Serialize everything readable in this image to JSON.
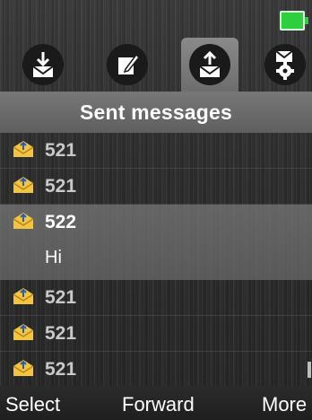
{
  "status_bar": {
    "battery_icon": "battery-full-icon",
    "battery_color": "#2ecf3f"
  },
  "tabs": [
    {
      "icon": "inbox-download-icon",
      "active": false
    },
    {
      "icon": "compose-pencil-icon",
      "active": false
    },
    {
      "icon": "outbox-upload-icon",
      "active": true
    },
    {
      "icon": "message-settings-gear-icon",
      "active": false
    }
  ],
  "header": {
    "title": "Sent messages"
  },
  "messages": [
    {
      "number": "521",
      "preview": "",
      "selected": false,
      "icon": "sent-envelope-icon"
    },
    {
      "number": "521",
      "preview": "",
      "selected": false,
      "icon": "sent-envelope-icon"
    },
    {
      "number": "522",
      "preview": "Hi",
      "selected": true,
      "icon": "sent-envelope-icon"
    },
    {
      "number": "521",
      "preview": "",
      "selected": false,
      "icon": "sent-envelope-icon"
    },
    {
      "number": "521",
      "preview": "",
      "selected": false,
      "icon": "sent-envelope-icon"
    },
    {
      "number": "521",
      "preview": "",
      "selected": false,
      "icon": "sent-envelope-icon"
    }
  ],
  "softkeys": {
    "left": "Select",
    "center": "Forward",
    "right": "More"
  },
  "colors": {
    "accent_tab": "#7a7a7a",
    "header_bg": "#6a6a6a",
    "selected_row": "#6e6e6e",
    "envelope": "#f2c440"
  }
}
